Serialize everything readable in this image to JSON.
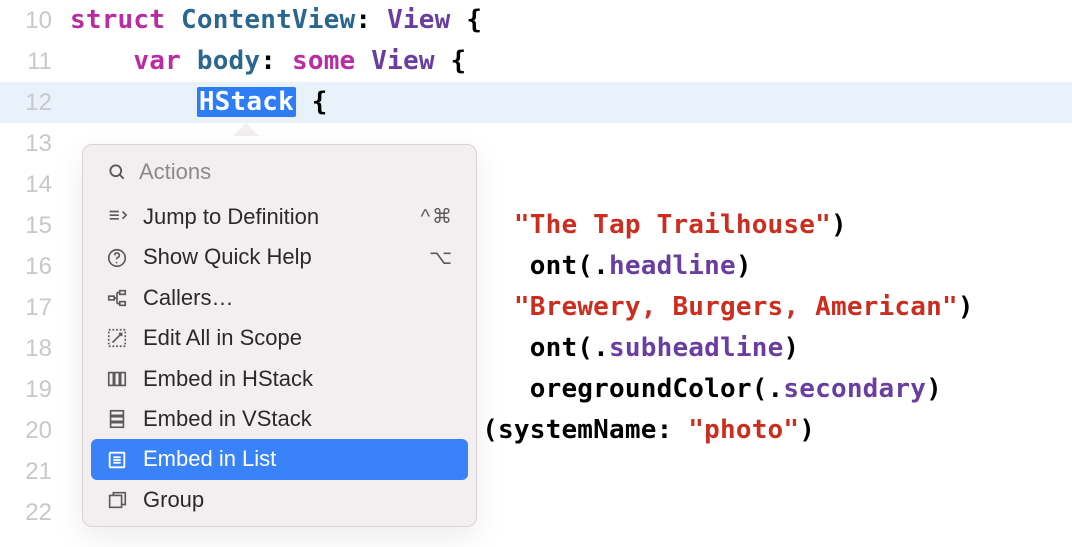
{
  "lines": [
    {
      "n": "10"
    },
    {
      "n": "11"
    },
    {
      "n": "12"
    },
    {
      "n": "13"
    },
    {
      "n": "14"
    },
    {
      "n": "15"
    },
    {
      "n": "16"
    },
    {
      "n": "17"
    },
    {
      "n": "18"
    },
    {
      "n": "19"
    },
    {
      "n": "20"
    },
    {
      "n": "21"
    },
    {
      "n": "22"
    }
  ],
  "code": {
    "struct_kw": "struct",
    "content_view": "ContentView",
    "colon1": ": ",
    "view_proto": "View",
    "brace_open": " {",
    "var_kw": "var",
    "body_name": "body",
    "colon2": ": ",
    "some_kw": "some",
    "view2": "View",
    "brace_open2": " {",
    "hstack": "HStack",
    "brace_open3": " {",
    "str1": "\"The Tap Trailhouse\"",
    "paren_close": ")",
    "font1_prefix": "ont(.",
    "headline": "headline",
    "str2": "\"Brewery, Burgers, American\"",
    "font2_prefix": "ont(.",
    "subheadline": "subheadline",
    "fg_prefix": "oregroundColor(.",
    "secondary": "secondary",
    "img_prefix": "(systemName: ",
    "photo_str": "\"photo\"",
    "paren_close2": ")"
  },
  "popup": {
    "search_placeholder": "Actions",
    "items": [
      {
        "icon": "definition",
        "label": "Jump to Definition",
        "shortcut": "^⌘"
      },
      {
        "icon": "help",
        "label": "Show Quick Help",
        "shortcut": "⌥"
      },
      {
        "icon": "callers",
        "label": "Callers…",
        "shortcut": ""
      },
      {
        "icon": "scope",
        "label": "Edit All in Scope",
        "shortcut": ""
      },
      {
        "icon": "hstack",
        "label": "Embed in HStack",
        "shortcut": ""
      },
      {
        "icon": "vstack",
        "label": "Embed in VStack",
        "shortcut": ""
      },
      {
        "icon": "list",
        "label": "Embed in List",
        "shortcut": "",
        "selected": true
      },
      {
        "icon": "group",
        "label": "Group",
        "shortcut": ""
      }
    ]
  }
}
